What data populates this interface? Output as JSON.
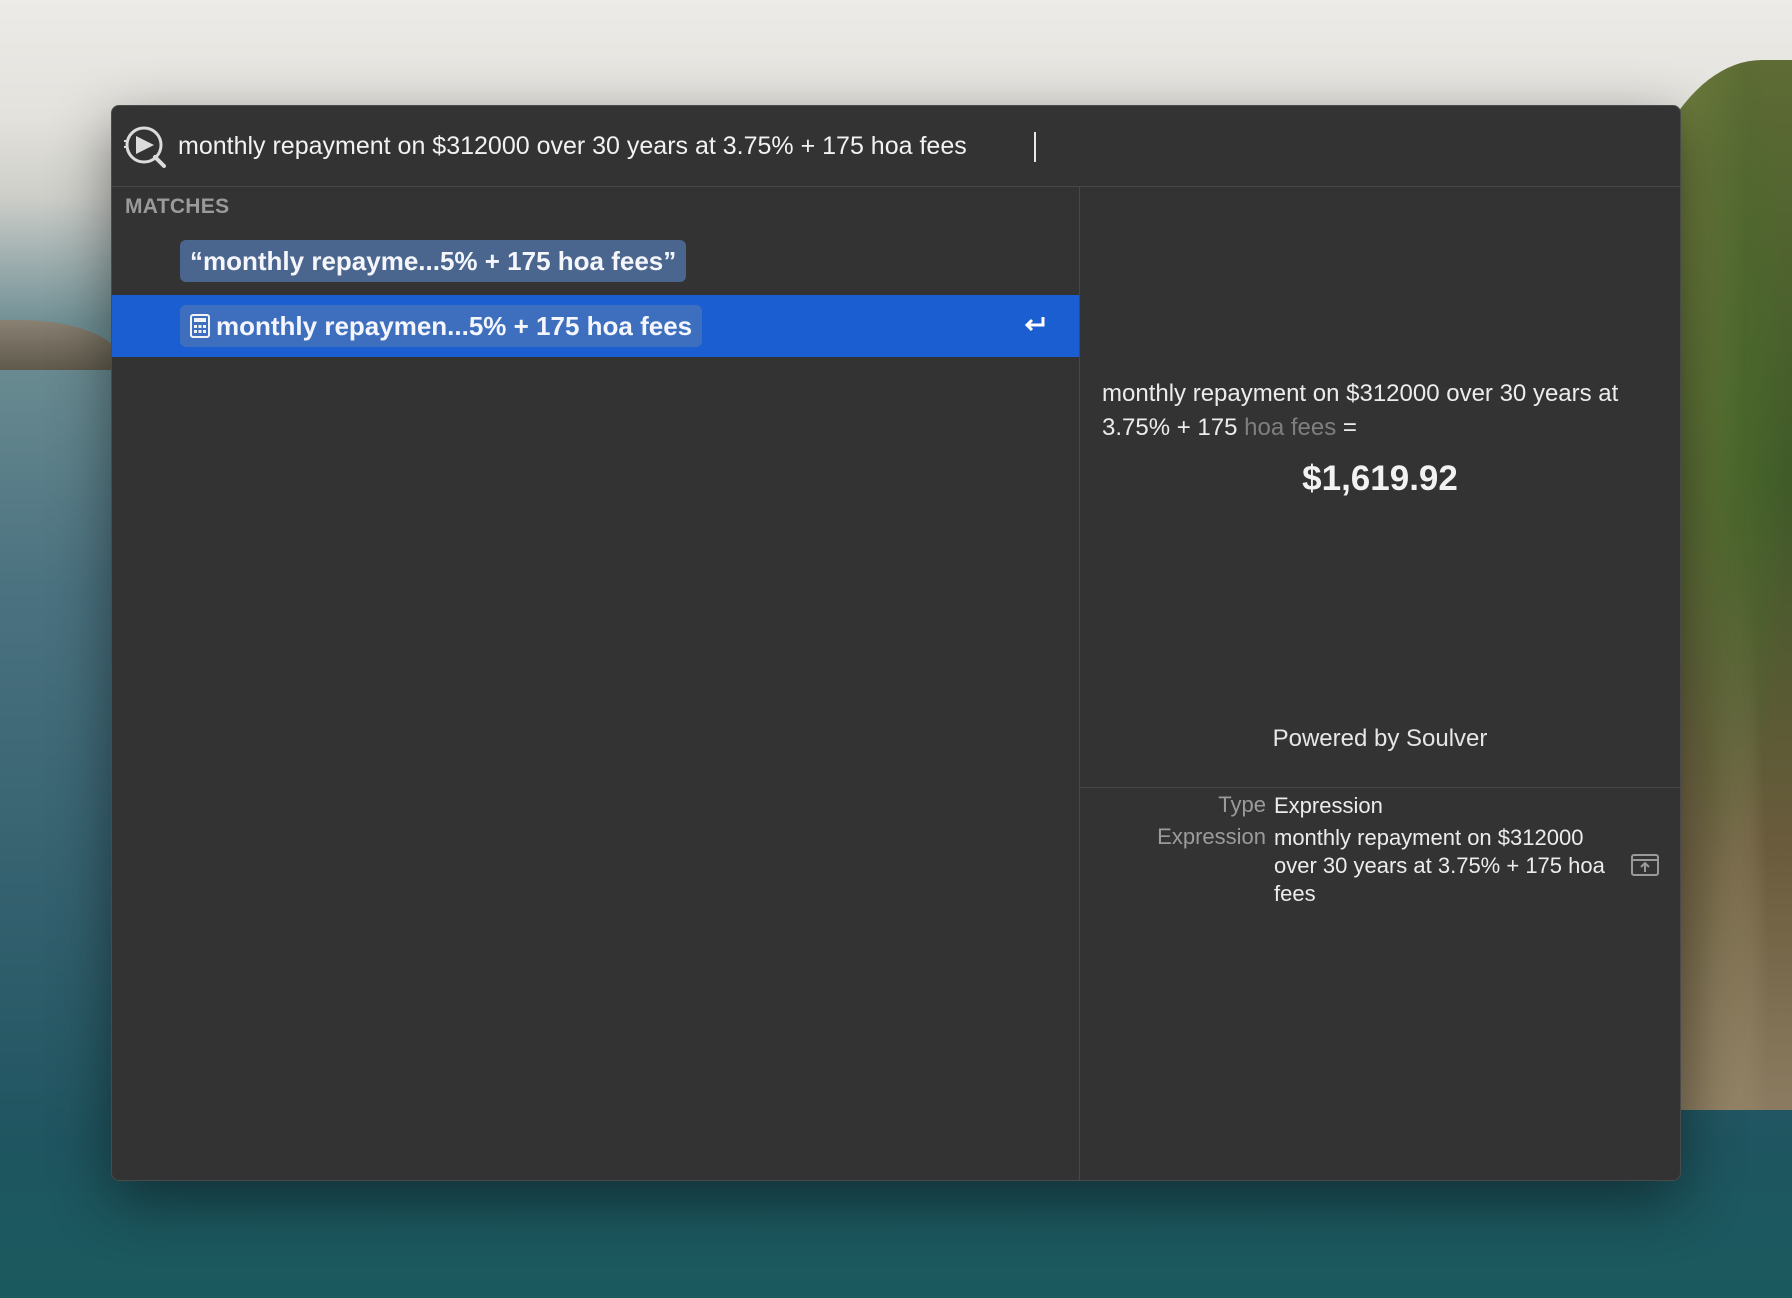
{
  "search": {
    "query": "monthly repayment on $312000 over 30 years at 3.75% + 175 hoa fees"
  },
  "matches": {
    "header": "MATCHES",
    "items": [
      {
        "label": "“monthly repayme...5% + 175 hoa fees”",
        "icon": "none",
        "selected": false
      },
      {
        "label": "monthly repaymen...5% + 175 hoa fees",
        "icon": "calculator-icon",
        "selected": true,
        "action_icon": "return-icon"
      }
    ]
  },
  "preview": {
    "expression_main": "monthly repayment on $312000 over 30 years at 3.75% + 175 ",
    "expression_muted": "hoa fees",
    "expression_equals": " =",
    "result": "$1,619.92",
    "powered_by": "Powered by Soulver"
  },
  "details": {
    "type_label": "Type",
    "type_value": "Expression",
    "expression_label": "Expression",
    "expression_value": "monthly repayment on $312000 over 30 years at 3.75% + 175 hoa fees"
  },
  "colors": {
    "window_bg": "#333333",
    "selection": "#1a5ed1",
    "pill": "#4a668f"
  }
}
